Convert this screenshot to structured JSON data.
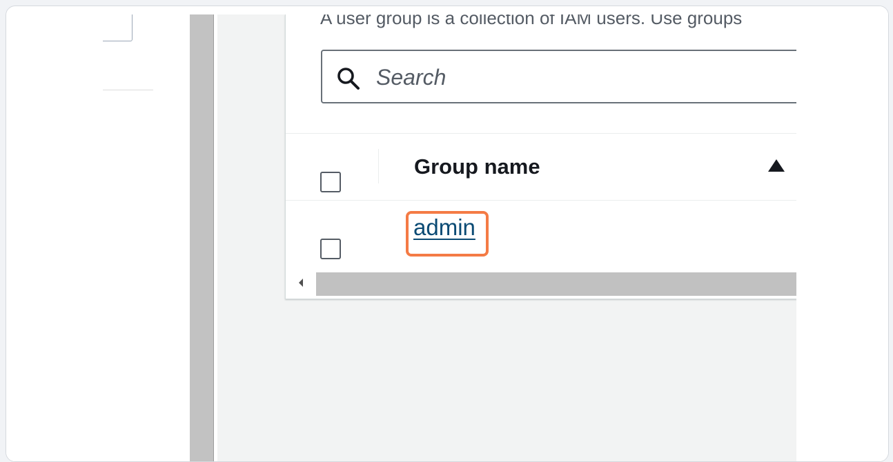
{
  "panel": {
    "description": "A user group is a collection of IAM users. Use groups"
  },
  "search": {
    "placeholder": "Search",
    "icon": "search-icon"
  },
  "table": {
    "columns": [
      {
        "label": "Group name",
        "sort": "ascending",
        "icon": "sort-up-triangle-icon"
      }
    ],
    "rows": [
      {
        "group_name": "admin",
        "selected": false
      }
    ]
  },
  "colors": {
    "link": "#0a4a74",
    "highlight": "#f47b45",
    "text": "#16191f",
    "secondary_text": "#545b64",
    "content_background": "#f2f3f3"
  }
}
